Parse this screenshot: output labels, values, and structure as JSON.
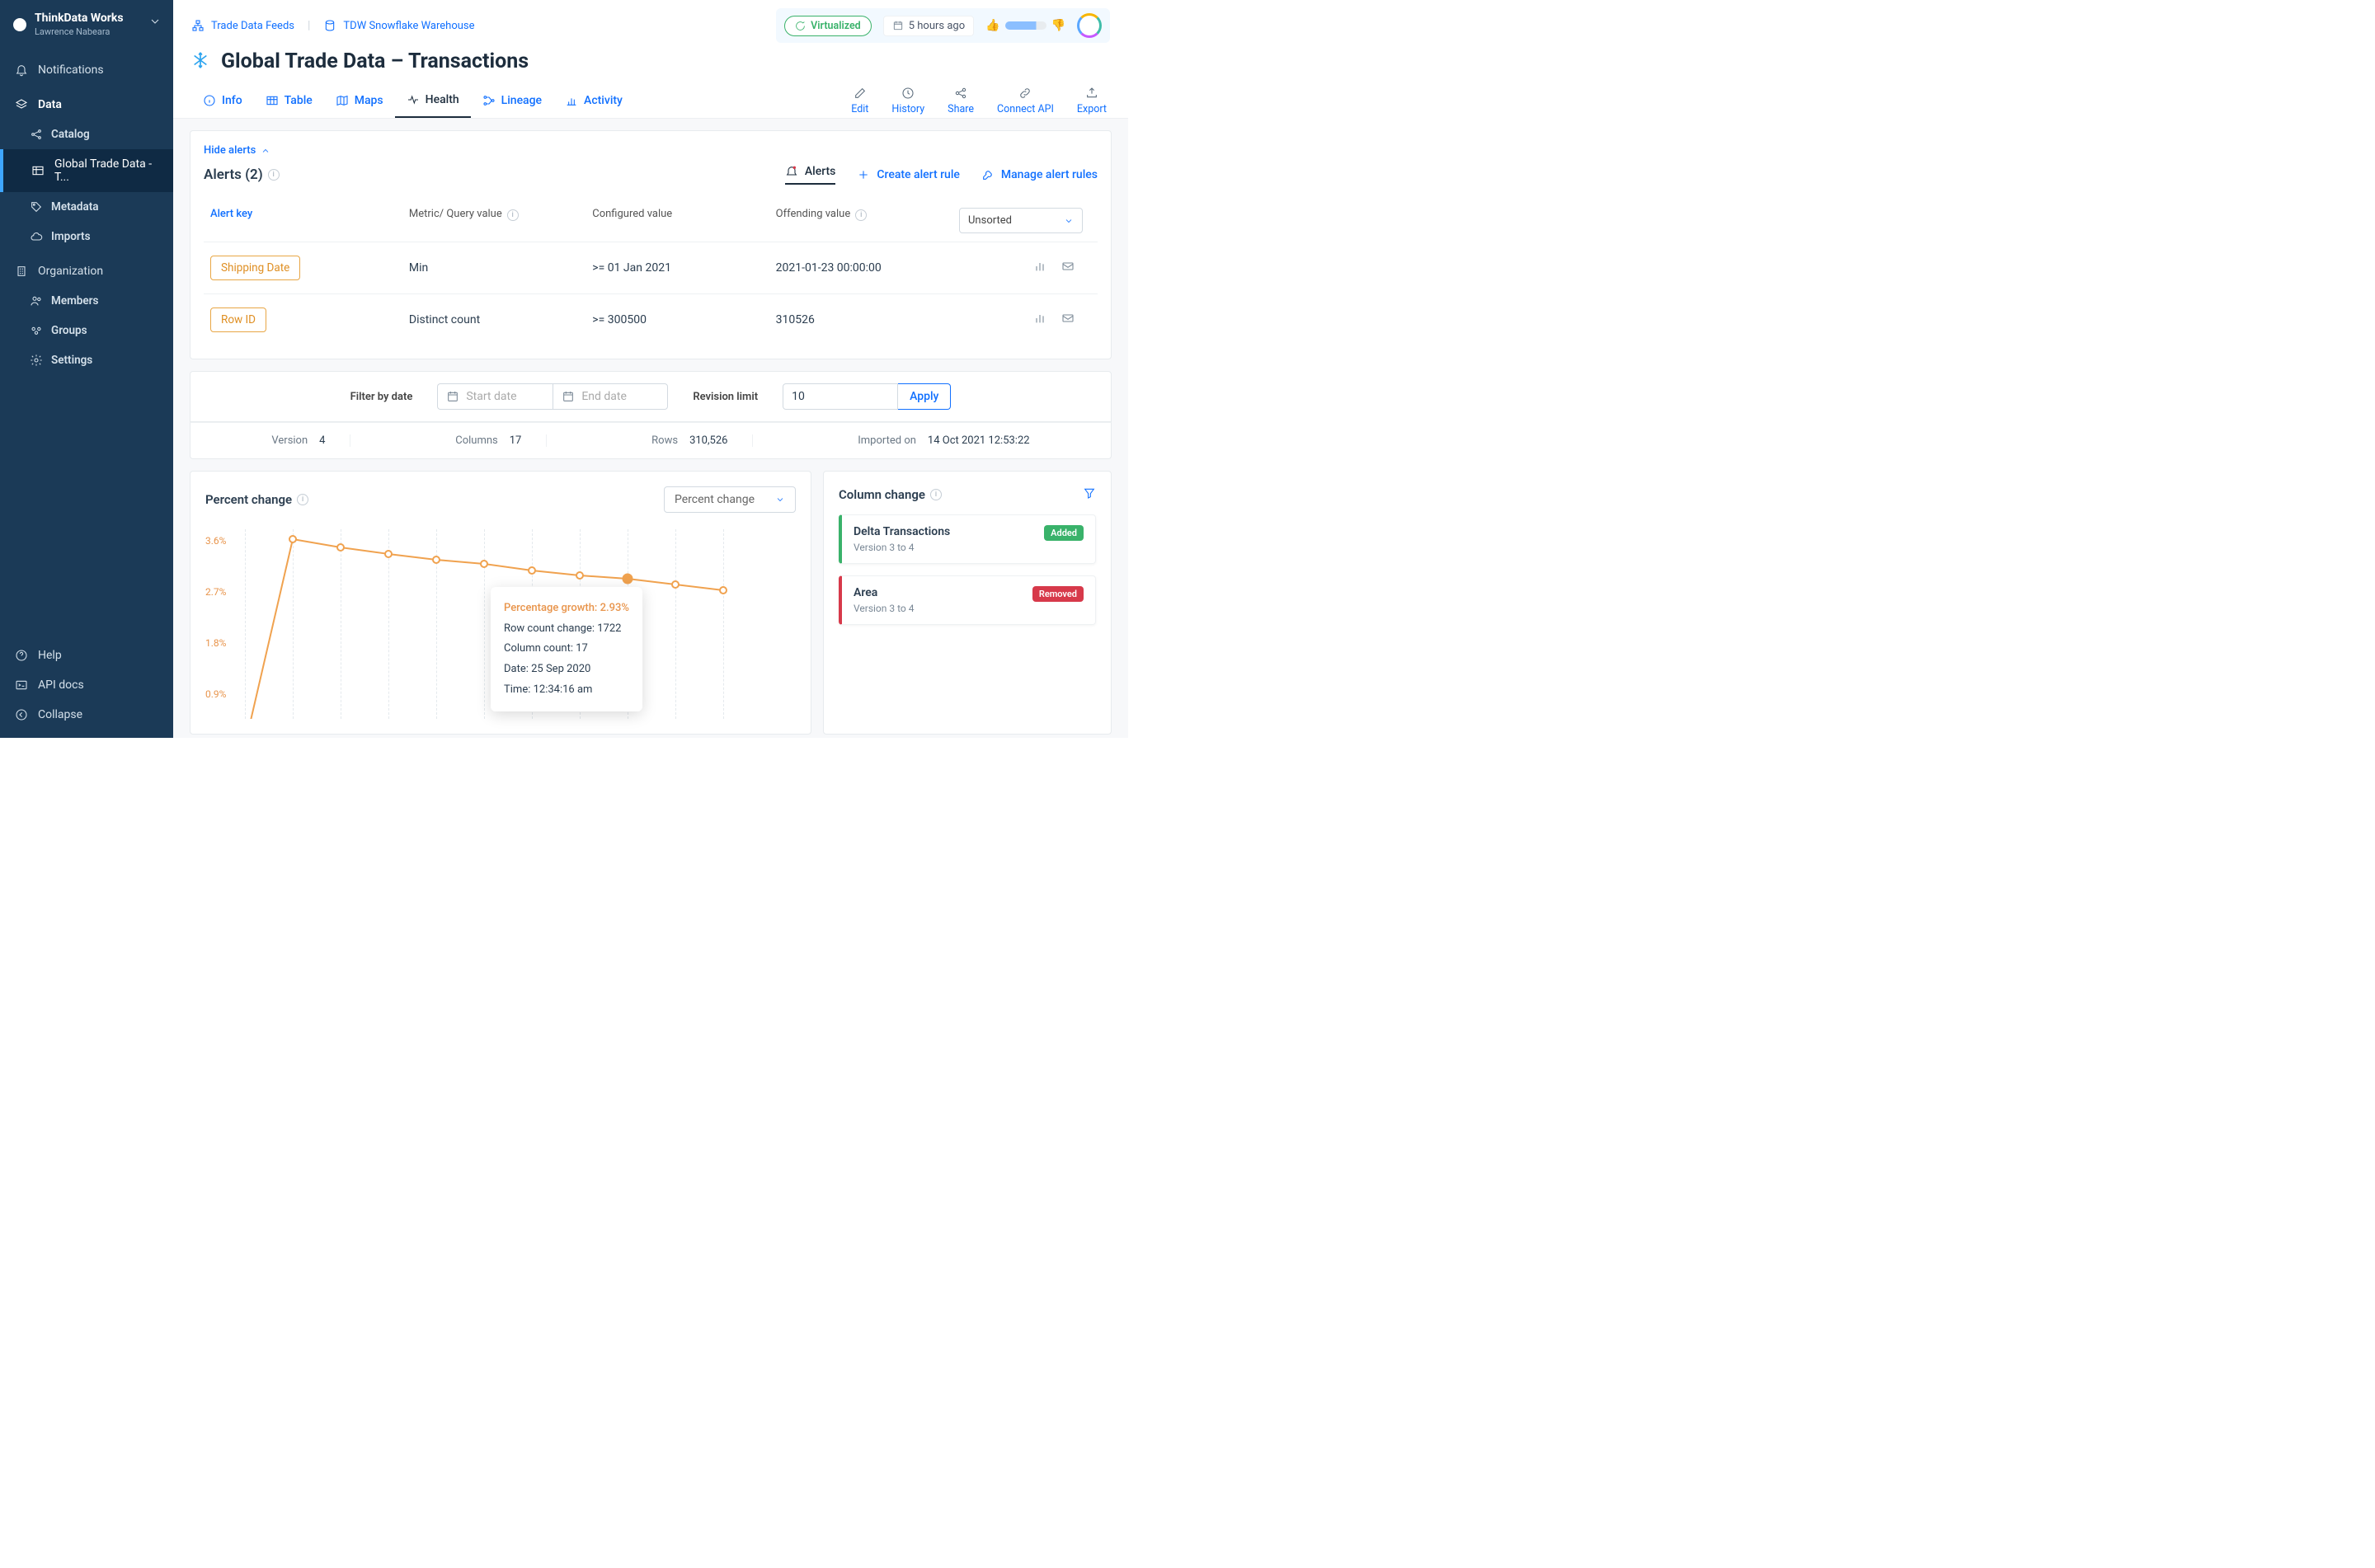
{
  "brand": {
    "name": "ThinkData Works",
    "user": "Lawrence Nabeara"
  },
  "sidebar": {
    "notifications": "Notifications",
    "data": "Data",
    "items": [
      {
        "label": "Catalog"
      },
      {
        "label": "Global Trade Data - T..."
      },
      {
        "label": "Metadata"
      },
      {
        "label": "Imports"
      }
    ],
    "organization": "Organization",
    "org_items": [
      {
        "label": "Members"
      },
      {
        "label": "Groups"
      },
      {
        "label": "Settings"
      }
    ],
    "bottom": {
      "help": "Help",
      "api_docs": "API docs",
      "collapse": "Collapse"
    }
  },
  "crumbs": {
    "a": "Trade Data Feeds",
    "b": "TDW Snowflake Warehouse"
  },
  "topbar": {
    "virtualized": "Virtualized",
    "time_ago": "5 hours ago"
  },
  "page_title": "Global Trade Data – Transactions",
  "tabs": {
    "info": "Info",
    "table": "Table",
    "maps": "Maps",
    "health": "Health",
    "lineage": "Lineage",
    "activity": "Activity"
  },
  "actions": {
    "edit": "Edit",
    "history": "History",
    "share": "Share",
    "connect": "Connect API",
    "export": "Export"
  },
  "alerts": {
    "hide": "Hide alerts",
    "title": "Alerts (2)",
    "tabs": {
      "alerts": "Alerts",
      "create": "Create alert rule",
      "manage": "Manage alert rules"
    },
    "cols": {
      "key": "Alert key",
      "metric": "Metric/ Query value",
      "config": "Configured value",
      "offending": "Offending value"
    },
    "sort": "Unsorted",
    "rows": [
      {
        "key": "Shipping Date",
        "metric": "Min",
        "config": ">= 01 Jan 2021",
        "offending": "2021-01-23 00:00:00"
      },
      {
        "key": "Row ID",
        "metric": "Distinct count",
        "config": ">= 300500",
        "offending": "310526"
      }
    ]
  },
  "filter": {
    "label": "Filter by date",
    "start_ph": "Start date",
    "end_ph": "End date",
    "rev_label": "Revision limit",
    "rev_value": "10",
    "apply": "Apply"
  },
  "meta": {
    "version_l": "Version",
    "version_v": "4",
    "cols_l": "Columns",
    "cols_v": "17",
    "rows_l": "Rows",
    "rows_v": "310,526",
    "imported_l": "Imported on",
    "imported_v": "14 Oct 2021 12:53:22"
  },
  "chart": {
    "title": "Percent change",
    "selector": "Percent change",
    "yticks": [
      "3.6%",
      "2.7%",
      "1.8%",
      "0.9%"
    ]
  },
  "chart_data": {
    "type": "line",
    "title": "Percent change",
    "ylabel": "Percentage growth",
    "yticks": [
      0.9,
      1.8,
      2.7,
      3.6
    ],
    "series": [
      {
        "name": "Percentage growth",
        "values": [
          0.0,
          3.62,
          3.48,
          3.35,
          3.26,
          3.18,
          3.07,
          2.98,
          2.93,
          2.82,
          2.72
        ]
      }
    ],
    "highlight_index": 8
  },
  "tooltip": {
    "head": "Percentage growth: 2.93%",
    "rows": [
      "Row count change: 1722",
      "Column count: 17",
      "Date: 25 Sep 2020",
      "Time: 12:34:16 am"
    ]
  },
  "col_change": {
    "title": "Column change",
    "items": [
      {
        "name": "Delta Transactions",
        "sub": "Version 3 to 4",
        "badge": "Added",
        "kind": "added"
      },
      {
        "name": "Area",
        "sub": "Version 3 to 4",
        "badge": "Removed",
        "kind": "removed"
      }
    ]
  }
}
